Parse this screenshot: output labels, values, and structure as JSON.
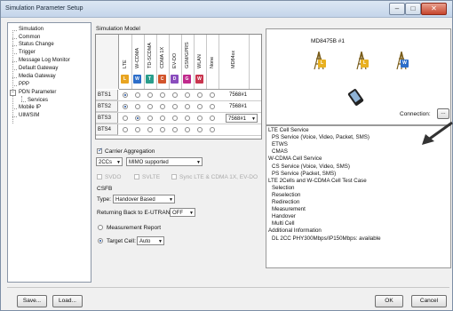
{
  "window": {
    "title": "Simulation Parameter Setup"
  },
  "nav": {
    "items": [
      {
        "label": "Simulation"
      },
      {
        "label": "Common"
      },
      {
        "label": "Status Change"
      },
      {
        "label": "Trigger"
      },
      {
        "label": "Message Log Monitor"
      },
      {
        "label": "Default Gateway"
      },
      {
        "label": "Media Gateway"
      },
      {
        "label": "PPP"
      },
      {
        "label": "PDN Parameter"
      },
      {
        "label": "Services"
      },
      {
        "label": "Mobile IP"
      },
      {
        "label": "UIM/SIM"
      }
    ]
  },
  "model": {
    "heading": "Simulation Model",
    "columns": [
      {
        "label": "LTE",
        "badge": "L",
        "color": "#e8a420"
      },
      {
        "label": "W-CDMA",
        "badge": "W",
        "color": "#2d6ec9"
      },
      {
        "label": "TD-SCDMA",
        "badge": "T",
        "color": "#2a9e8c"
      },
      {
        "label": "CDMA 1X",
        "badge": "C",
        "color": "#d2542b"
      },
      {
        "label": "EV-DO",
        "badge": "D",
        "color": "#8a4dbd"
      },
      {
        "label": "GSM/GPRS",
        "badge": "G",
        "color": "#c02a8c"
      },
      {
        "label": "WLAN",
        "badge": "W",
        "color": "#c9354e"
      },
      {
        "label": "None",
        "badge": "",
        "color": ""
      },
      {
        "label": "MD84xx",
        "badge": "",
        "color": ""
      }
    ],
    "rows": [
      {
        "label": "BTS1",
        "selected": 0,
        "md": "7568#1",
        "has_dropdown": false
      },
      {
        "label": "BTS2",
        "selected": 0,
        "md": "7568#1",
        "has_dropdown": false
      },
      {
        "label": "BTS3",
        "selected": 1,
        "md": "7568#1",
        "has_dropdown": true
      },
      {
        "label": "BTS4",
        "selected": 8,
        "md": "",
        "has_dropdown": false
      }
    ]
  },
  "carrier": {
    "label": "Carrier Aggregation",
    "checked": true,
    "cc_value": "2CCs",
    "mimo_value": "MIMO supported"
  },
  "options": {
    "svdo": "SVDO",
    "svlte": "SVLTE",
    "sync": "Sync LTE & CDMA 1X, EV-DO"
  },
  "csfb": {
    "heading": "CSFB",
    "type_label": "Type:",
    "type_value": "Handover Based",
    "return_label": "Returning Back to E-UTRAN:",
    "return_value": "OFF",
    "measurement_label": "Measurement Report",
    "target_label": "Target Cell:",
    "target_value": "Auto"
  },
  "diagram": {
    "device_label": "MD8475B #1",
    "connection_label": "Connection:",
    "connection_button": "...",
    "badges": [
      "L",
      "L",
      "W"
    ]
  },
  "info": {
    "lines": [
      {
        "text": "LTE Cell Service",
        "indent": 0
      },
      {
        "text": "PS Service (Voice, Video, Packet, SMS)",
        "indent": 1
      },
      {
        "text": "ETWS",
        "indent": 1
      },
      {
        "text": "CMAS",
        "indent": 1
      },
      {
        "text": "W-CDMA Cell Service",
        "indent": 0
      },
      {
        "text": "CS Service (Voice, Video, SMS)",
        "indent": 1
      },
      {
        "text": "PS Service (Packet, SMS)",
        "indent": 1
      },
      {
        "text": "LTE 2Cells and W-CDMA Cell Test Case",
        "indent": 0
      },
      {
        "text": "Selection",
        "indent": 1
      },
      {
        "text": "Reselection",
        "indent": 1
      },
      {
        "text": "Redirection",
        "indent": 1
      },
      {
        "text": "Measurement",
        "indent": 1
      },
      {
        "text": "Handover",
        "indent": 1
      },
      {
        "text": "Multi Cell",
        "indent": 1
      },
      {
        "text": "Additional Information",
        "indent": 0
      },
      {
        "text": "DL 2CC PHY300Mbps/IP150Mbps: available",
        "indent": 1
      }
    ]
  },
  "buttons": {
    "save": "Save...",
    "load": "Load...",
    "ok": "OK",
    "cancel": "Cancel"
  }
}
